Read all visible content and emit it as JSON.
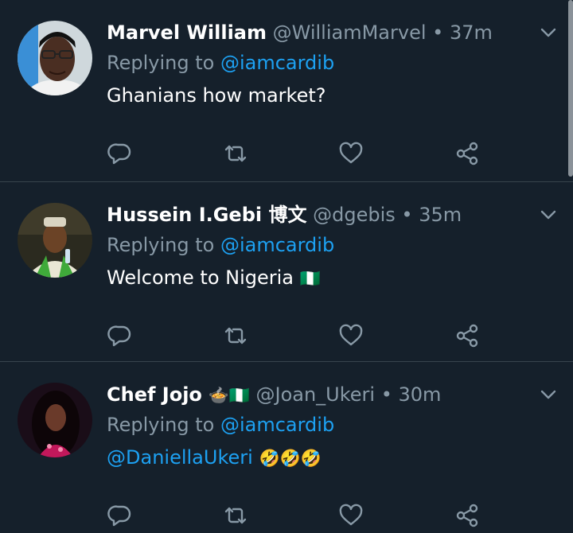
{
  "tweets": [
    {
      "name": "Marvel William",
      "handle": "@WilliamMarvel",
      "dot": "•",
      "time": "37m",
      "replying_prefix": "Replying to ",
      "replying_to": "@iamcardib",
      "body_text": "Ghanians how market?",
      "body_mention": "",
      "body_emoji": "",
      "name_emoji": ""
    },
    {
      "name": "Hussein I.Gebi 博文",
      "handle": "@dgebis",
      "dot": "•",
      "time": "35m",
      "replying_prefix": "Replying to ",
      "replying_to": "@iamcardib",
      "body_text": "Welcome to Nigeria",
      "body_mention": "",
      "body_emoji": "🇳🇬",
      "name_emoji": ""
    },
    {
      "name": "Chef Jojo",
      "handle": "@Joan_Ukeri",
      "dot": "•",
      "time": "30m",
      "replying_prefix": "Replying to ",
      "replying_to": "@iamcardib",
      "body_text": "",
      "body_mention": "@DaniellaUkeri",
      "body_emoji": "🤣🤣🤣",
      "name_emoji": "🍲🇳🇬"
    }
  ],
  "colors": {
    "background": "#15202b",
    "divider": "#38444d",
    "secondary_text": "#8899a6",
    "accent": "#1da1f2",
    "icon": "#8899a6"
  },
  "icons": {
    "reply": "reply-icon",
    "retweet": "retweet-icon",
    "like": "heart-icon",
    "share": "share-icon",
    "menu": "chevron-down-icon"
  }
}
